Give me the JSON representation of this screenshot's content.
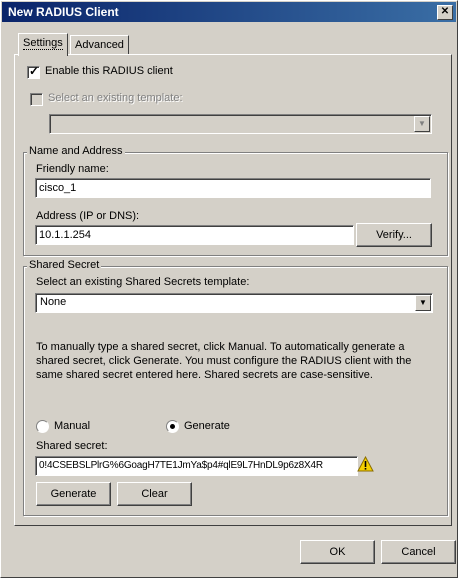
{
  "window": {
    "title": "New RADIUS Client",
    "close_glyph": "✕"
  },
  "tabs": [
    {
      "label": "Settings",
      "active": true
    },
    {
      "label": "Advanced",
      "active": false
    }
  ],
  "enable_client": {
    "label": "Enable this RADIUS client",
    "checked": true,
    "mark": "✓"
  },
  "existing_template": {
    "label": "Select an existing template:",
    "checked": false,
    "value": ""
  },
  "name_address": {
    "group_label": "Name and Address",
    "friendly_name_label": "Friendly name:",
    "friendly_name_value": "cisco_1",
    "address_label": "Address (IP or DNS):",
    "address_value": "10.1.1.254",
    "verify_label": "Verify..."
  },
  "shared_secret": {
    "group_label": "Shared Secret",
    "template_label": "Select an existing Shared Secrets template:",
    "template_value": "None",
    "info_text": "To manually type a shared secret, click Manual. To automatically generate a shared secret, click Generate. You must configure the RADIUS client with the same shared secret entered here. Shared secrets are case-sensitive.",
    "manual_label": "Manual",
    "generate_label": "Generate",
    "selected_mode": "Generate",
    "secret_label": "Shared secret:",
    "secret_value": "0!4CSEBSLPlrG%6GoagH7TE1JmYa$p4#qlE9L7HnDL9p6z8X4R",
    "generate_button": "Generate",
    "clear_button": "Clear"
  },
  "footer": {
    "ok_label": "OK",
    "cancel_label": "Cancel"
  },
  "colors": {
    "title_bar": "#0a246a",
    "face": "#d4d0c8",
    "warning": "#f5d000"
  },
  "icons": {
    "warning": "warning-icon",
    "dropdown": "chevron-down-icon",
    "close": "close-icon"
  }
}
